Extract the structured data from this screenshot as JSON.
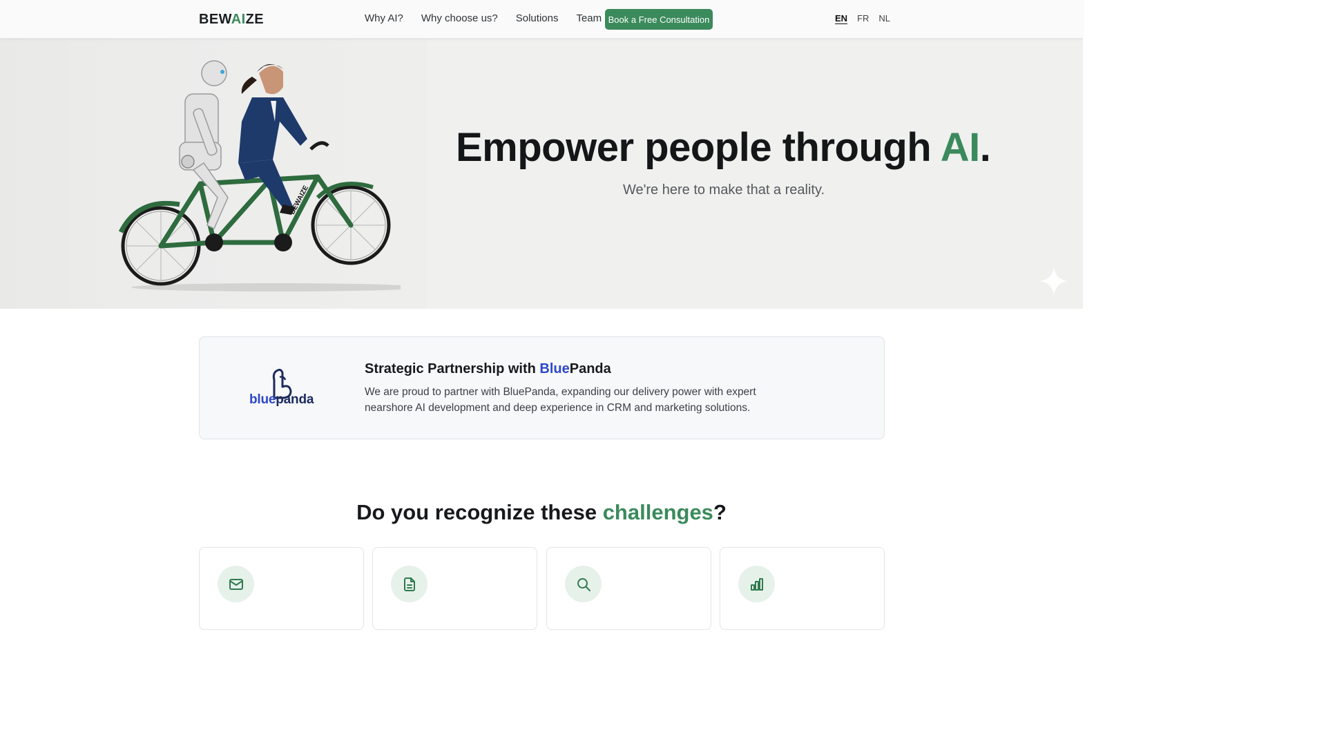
{
  "header": {
    "logo_prefix": "BEW",
    "logo_ai": "AI",
    "logo_suffix": "ZE",
    "nav": [
      "Why AI?",
      "Why choose us?",
      "Solutions",
      "Team"
    ],
    "cta_label": "Book a Free Consultation",
    "languages": [
      "EN",
      "FR",
      "NL"
    ],
    "active_language": "EN"
  },
  "hero": {
    "title_main": "Empower people through ",
    "title_ai": "AI",
    "title_end": ".",
    "subtitle": "We're here to make that a reality.",
    "illustration_label": "BEWAIZE"
  },
  "partner": {
    "logo_blue": "blue",
    "logo_panda": "panda",
    "title_prefix": "Strategic Partnership with ",
    "title_blue": "Blue",
    "title_panda": "Panda",
    "description": "We are proud to partner with BluePanda, expanding our delivery power with expert nearshore AI development and deep experience in CRM and marketing solutions."
  },
  "challenges": {
    "title_prefix": "Do you recognize these ",
    "title_highlight": "challenges",
    "title_suffix": "?",
    "cards": [
      {
        "icon": "mail-icon"
      },
      {
        "icon": "document-icon"
      },
      {
        "icon": "search-icon"
      },
      {
        "icon": "bar-chart-icon"
      }
    ]
  },
  "colors": {
    "accent_green": "#3b8a5c",
    "partner_blue": "#2d48c8",
    "partner_navy": "#1c2a5e"
  }
}
